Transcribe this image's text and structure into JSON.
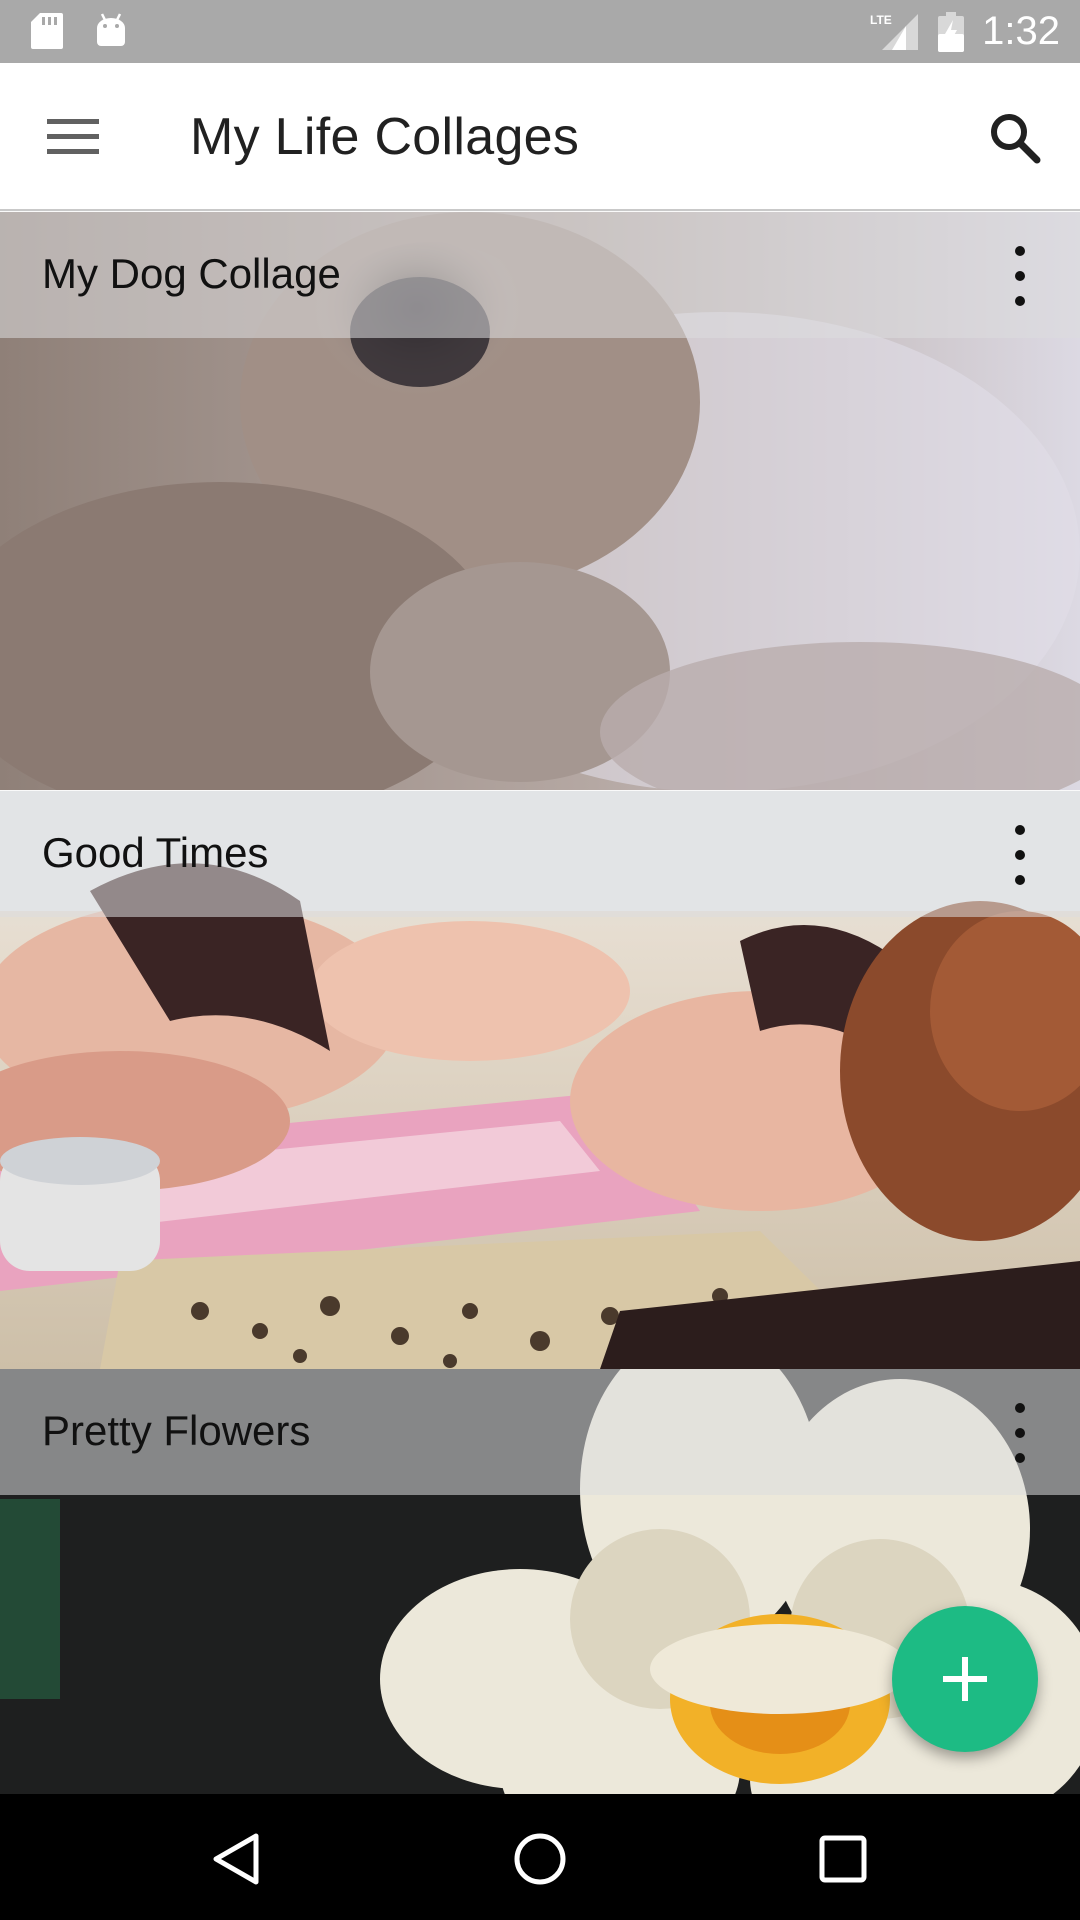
{
  "status_bar": {
    "time": "1:32",
    "network": "LTE",
    "icons": [
      "sd-card-icon",
      "android-icon",
      "lte-signal-icon",
      "battery-icon"
    ]
  },
  "app_bar": {
    "title": "My Life Collages",
    "menu_icon": "hamburger-menu-icon",
    "search_icon": "search-icon"
  },
  "collages": [
    {
      "title": "My Dog Collage",
      "more_icon": "more-vert-icon"
    },
    {
      "title": "Good Times",
      "more_icon": "more-vert-icon"
    },
    {
      "title": "Pretty Flowers",
      "more_icon": "more-vert-icon"
    }
  ],
  "fab": {
    "icon": "add-icon",
    "color": "#1dbb84"
  },
  "nav_bar": {
    "icons": [
      "back-icon",
      "home-icon",
      "recents-icon"
    ]
  }
}
